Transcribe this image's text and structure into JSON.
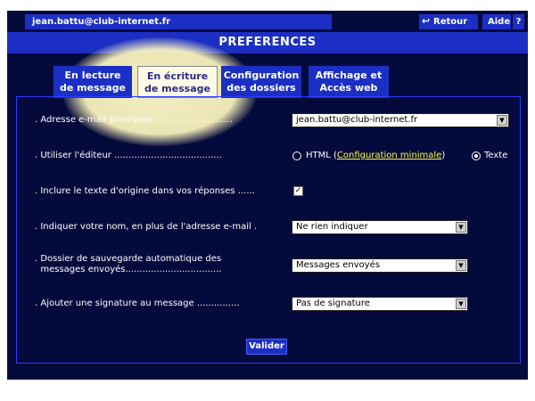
{
  "header": {
    "user_email": "jean.battu@club-internet.fr",
    "retour_label": "Retour",
    "retour_icon": "back-arrow-icon",
    "aide_label": "Aide",
    "help_icon_glyph": "?"
  },
  "page_title": "PREFERENCES",
  "tabs": [
    {
      "label_line1": "En lecture",
      "label_line2": "de message",
      "active": false
    },
    {
      "label_line1": "En écriture",
      "label_line2": "de message",
      "active": true
    },
    {
      "label_line1": "Configuration",
      "label_line2": "des dossiers",
      "active": false
    },
    {
      "label_line1": "Affichage et",
      "label_line2": "Accès web",
      "active": false
    }
  ],
  "form": {
    "main_address": {
      "label": ". Adresse e-mail principale ...........................",
      "value": "jean.battu@club-internet.fr"
    },
    "editor": {
      "label": ". Utiliser l'éditeur ......................................",
      "html_option": "HTML (",
      "html_link": "Configuration minimale",
      "html_close": ")",
      "text_option": "Texte",
      "selected": "Texte"
    },
    "include_original": {
      "label": ". Inclure le texte d'origine dans vos réponses ......",
      "checked": true
    },
    "display_name": {
      "label": ". Indiquer votre nom, en plus de l'adresse e-mail .",
      "value": "Ne rien indiquer"
    },
    "save_folder": {
      "label_line1": ". Dossier de sauvegarde automatique des",
      "label_line2": "  messages envoyés..................................",
      "value": "Messages envoyés"
    },
    "signature": {
      "label": ". Ajouter une signature au message ...............",
      "value": "Pas de signature"
    },
    "submit_label": "Valider"
  },
  "colors": {
    "background": "#050a3c",
    "accent_blue": "#1c2fc4",
    "link_yellow": "#ffff40",
    "active_tab_bg": "#fdfbe6",
    "spotlight": "#fff8c0"
  }
}
